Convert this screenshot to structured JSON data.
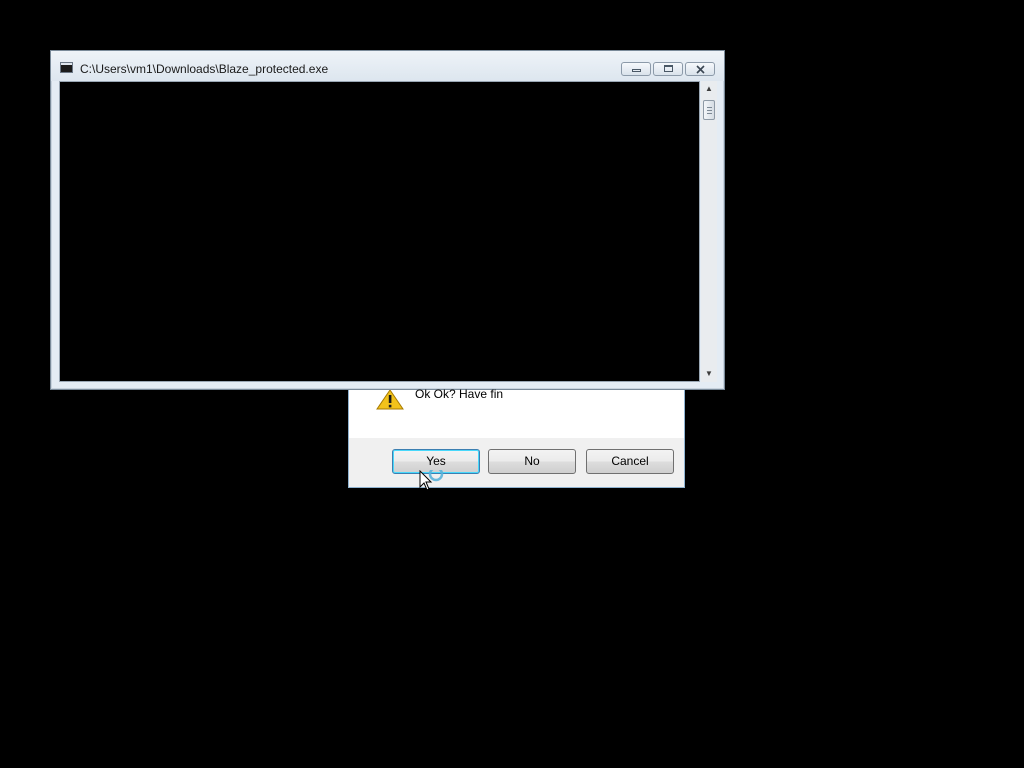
{
  "console_window": {
    "title": "C:\\Users\\vm1\\Downloads\\Blaze_protected.exe",
    "icon": "console-app-icon",
    "controls": {
      "minimize": "minimize-icon",
      "maximize": "maximize-icon",
      "close": "close-icon"
    }
  },
  "message_box": {
    "icon": "warning-icon",
    "message": "Ok Ok? Have fin",
    "buttons": {
      "yes": "Yes",
      "no": "No",
      "cancel": "Cancel"
    }
  },
  "colors": {
    "desktop": "#000000",
    "console_background": "#000000",
    "warning": "#f2c21b",
    "focus_border": "#3c7fb1"
  }
}
